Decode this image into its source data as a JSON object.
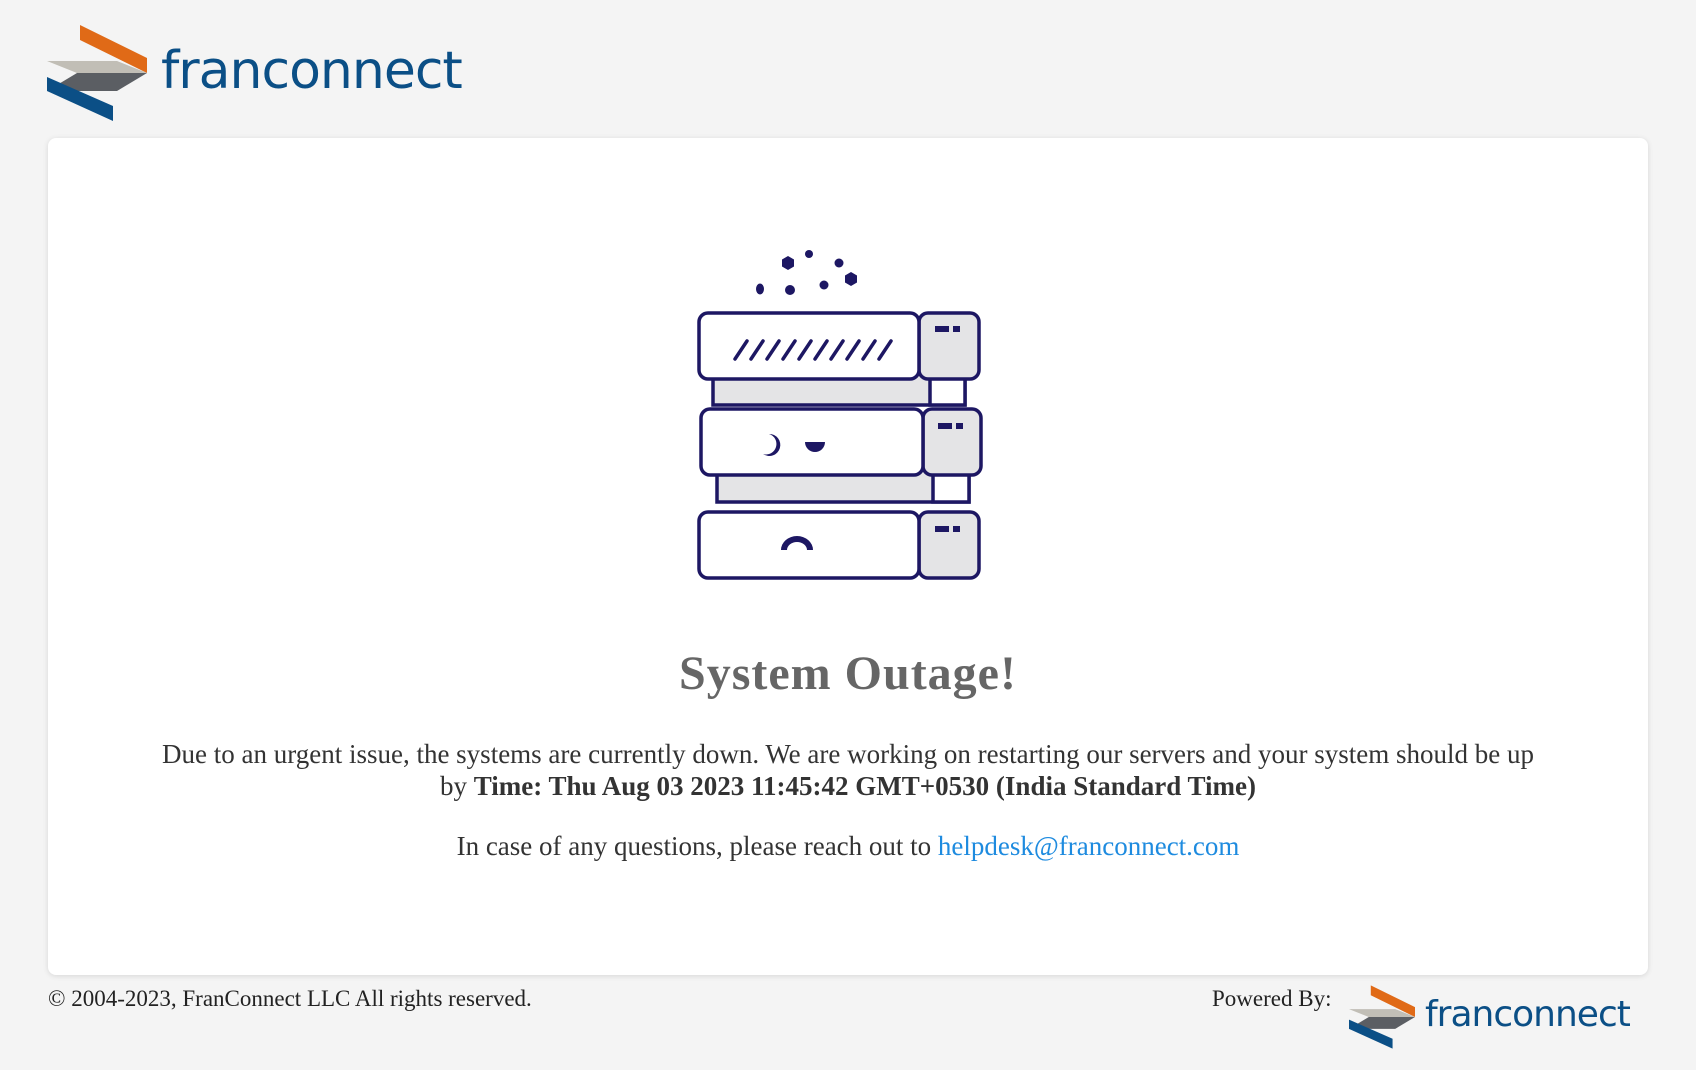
{
  "header": {
    "logo_text": "franconnect"
  },
  "main": {
    "title": "System Outage!",
    "message_prefix": "Due to an urgent issue, the systems are currently down. We are working on restarting our servers and your system should be up by",
    "message_time": "Time: Thu Aug 03 2023 11:45:42 GMT+0530 (India Standard Time)",
    "contact_prefix": "In case of any questions, please reach out to",
    "contact_email": "helpdesk@franconnect.com"
  },
  "footer": {
    "copyright": "© 2004-2023, FranConnect LLC All rights reserved.",
    "powered_label": "Powered By:",
    "logo_text": "franconnect"
  },
  "colors": {
    "brand_blue": "#0b4f86",
    "brand_orange": "#e06a17",
    "logo_grey": "#5b5e63",
    "logo_light": "#c1beb6",
    "illustration_navy": "#1d1763",
    "link": "#1e8bdf"
  },
  "icons": [
    "franconnect-logo-icon",
    "server-outage-illustration"
  ]
}
